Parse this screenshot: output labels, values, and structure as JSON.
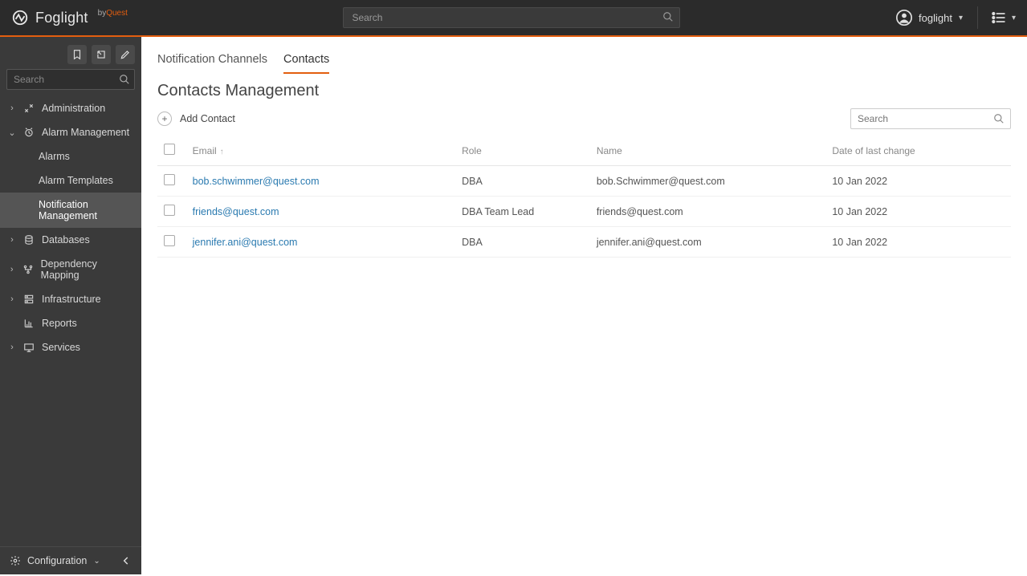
{
  "brand": {
    "name": "Foglight",
    "byPrefix": "by",
    "bySuffix": "Quest"
  },
  "topbar": {
    "searchPlaceholder": "Search",
    "userName": "foglight"
  },
  "sidebar": {
    "searchPlaceholder": "Search",
    "items": [
      {
        "label": "Administration",
        "hasChildren": true,
        "expanded": false
      },
      {
        "label": "Alarm Management",
        "hasChildren": true,
        "expanded": true,
        "children": [
          {
            "label": "Alarms"
          },
          {
            "label": "Alarm Templates"
          },
          {
            "label": "Notification Management",
            "active": true
          }
        ]
      },
      {
        "label": "Databases",
        "hasChildren": true,
        "expanded": false
      },
      {
        "label": "Dependency Mapping",
        "hasChildren": true,
        "expanded": false
      },
      {
        "label": "Infrastructure",
        "hasChildren": true,
        "expanded": false
      },
      {
        "label": "Reports",
        "hasChildren": false
      },
      {
        "label": "Services",
        "hasChildren": true,
        "expanded": false
      }
    ],
    "footerLabel": "Configuration"
  },
  "tabs": [
    {
      "label": "Notification Channels",
      "active": false
    },
    {
      "label": "Contacts",
      "active": true
    }
  ],
  "page": {
    "title": "Contacts Management",
    "addLabel": "Add Contact",
    "tableSearchPlaceholder": "Search"
  },
  "table": {
    "columns": {
      "email": "Email",
      "role": "Role",
      "name": "Name",
      "date": "Date of last change"
    },
    "rows": [
      {
        "email": "bob.schwimmer@quest.com",
        "role": "DBA",
        "name": "bob.Schwimmer@quest.com",
        "date": "10 Jan 2022"
      },
      {
        "email": "friends@quest.com",
        "role": "DBA Team Lead",
        "name": "friends@quest.com",
        "date": "10 Jan 2022"
      },
      {
        "email": "jennifer.ani@quest.com",
        "role": "DBA",
        "name": "jennifer.ani@quest.com",
        "date": "10 Jan 2022"
      }
    ]
  }
}
